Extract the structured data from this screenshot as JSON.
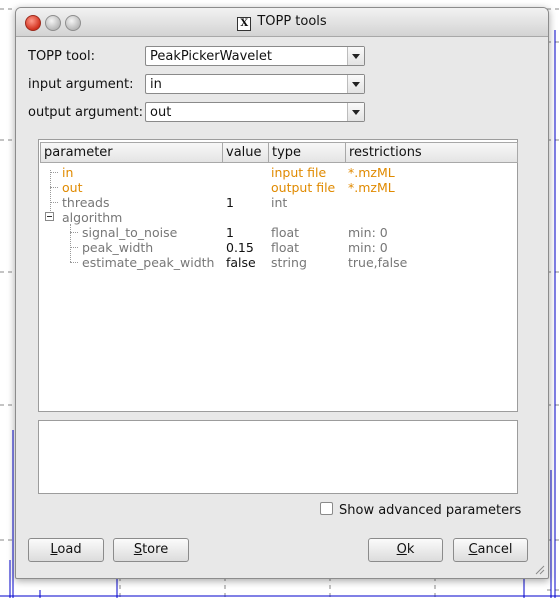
{
  "window": {
    "title": "TOPP tools"
  },
  "form": {
    "tool_label": "TOPP tool:",
    "tool_value": "PeakPickerWavelet",
    "input_label": "input argument:",
    "input_value": "in",
    "output_label": "output argument:",
    "output_value": "out"
  },
  "table": {
    "headers": [
      "parameter",
      "value",
      "type",
      "restrictions"
    ],
    "rows": [
      {
        "name": "in",
        "value": "",
        "type": "input file",
        "restrictions": "*.mzML"
      },
      {
        "name": "out",
        "value": "",
        "type": "output file",
        "restrictions": "*.mzML"
      },
      {
        "name": "threads",
        "value": "1",
        "type": "int",
        "restrictions": ""
      },
      {
        "name": "algorithm",
        "value": "",
        "type": "",
        "restrictions": ""
      },
      {
        "name": "signal_to_noise",
        "value": "1",
        "type": "float",
        "restrictions": "min: 0"
      },
      {
        "name": "peak_width",
        "value": "0.15",
        "type": "float",
        "restrictions": "min: 0"
      },
      {
        "name": "estimate_peak_width",
        "value": "false",
        "type": "string",
        "restrictions": "true,false"
      }
    ],
    "colors": {
      "required": "#e08a00",
      "muted": "#777777",
      "value": "#111111"
    }
  },
  "options": {
    "show_advanced_label": "Show advanced parameters",
    "show_advanced_checked": false
  },
  "buttons": {
    "load_u": "L",
    "load_rest": "oad",
    "store_u": "S",
    "store_rest": "tore",
    "ok_u": "O",
    "ok_rest": "k",
    "cancel_u": "C",
    "cancel_rest": "ancel"
  },
  "icons": {
    "title_icon": "x-window-icon",
    "expand": "tree-minus-icon"
  }
}
